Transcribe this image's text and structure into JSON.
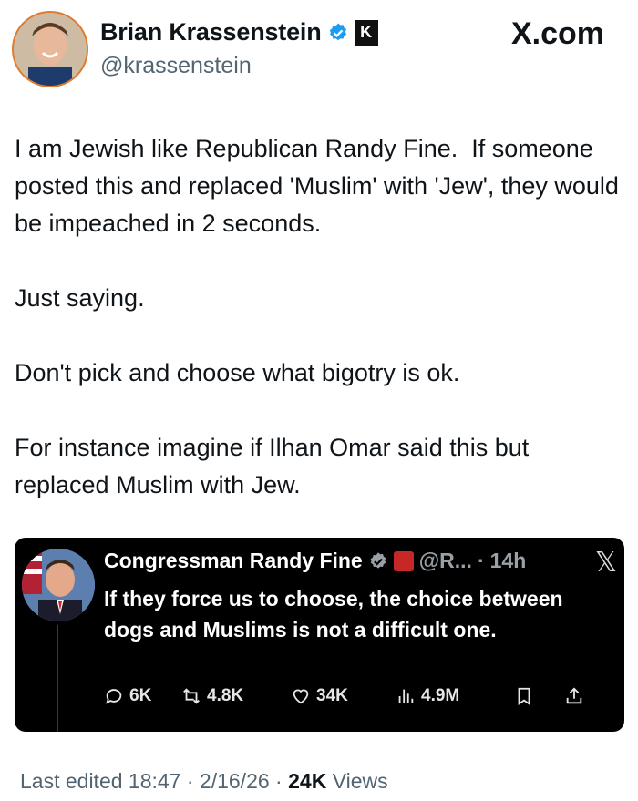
{
  "author": {
    "name": "Brian Krassenstein",
    "handle": "@krassenstein",
    "badge_letter": "K"
  },
  "site": "X.com",
  "tweet": {
    "paragraphs": [
      "I am Jewish like Republican Randy Fine.  If someone posted this and replaced 'Muslim' with 'Jew', they would be impeached in 2 seconds.",
      "Just saying.",
      "Don't pick and choose what bigotry is ok.",
      "For instance imagine if Ilhan Omar said this but replaced Muslim with Jew."
    ]
  },
  "quote": {
    "name": "Congressman Randy Fine",
    "handle": "@R...",
    "dot": "·",
    "time": "14h",
    "text": "If they force us to choose, the choice between dogs and Muslims is not a difficult one.",
    "metrics": {
      "replies": "6K",
      "reposts": "4.8K",
      "likes": "34K",
      "views": "4.9M"
    }
  },
  "footer": {
    "edited": "Last edited 18:47 · 2/16/26",
    "sep": "·",
    "views_count": "24K",
    "views_label": "Views"
  },
  "icons": [
    "verified-icon",
    "k-badge-icon",
    "x-logo-icon",
    "flag-icon",
    "reply-icon",
    "repost-icon",
    "like-icon",
    "views-icon",
    "bookmark-icon",
    "share-icon"
  ]
}
